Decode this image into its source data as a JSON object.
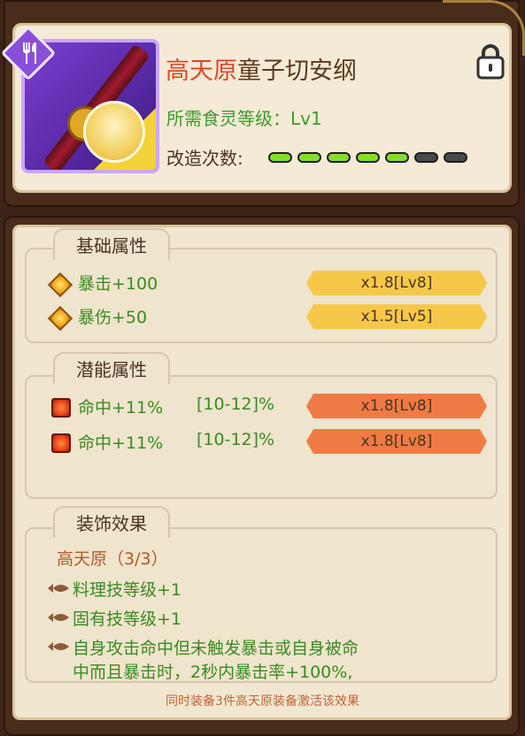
{
  "item": {
    "name_prefix": "高天原",
    "name_main": "童子切安纲",
    "requirement": "所需食灵等级：Lv1",
    "modification_label": "改造次数:",
    "modification_filled": 5,
    "modification_total": 7,
    "category_icon": "fork-knife-icon"
  },
  "sections": {
    "basic": {
      "title": "基础属性",
      "rows": [
        {
          "label": "暴击+100",
          "value": "x1.8[Lv8]"
        },
        {
          "label": "暴伤+50",
          "value": "x1.5[Lv5]"
        }
      ]
    },
    "potential": {
      "title": "潜能属性",
      "rows": [
        {
          "label": "命中+11%",
          "range": "[10-12]%",
          "value": "x1.8[Lv8]"
        },
        {
          "label": "命中+11%",
          "range": "[10-12]%",
          "value": "x1.8[Lv8]"
        }
      ]
    },
    "set": {
      "title": "装饰效果",
      "set_name": "高天原（3/3）",
      "effects": [
        "料理技等级+1",
        "固有技等级+1",
        "自身攻击命中但未触发暴击或自身被命",
        "中而且暴击时，2秒内暴击率+100%,"
      ],
      "footer": "同时装备3件高天原装备激活该效果"
    }
  },
  "colors": {
    "frame": "#4a2c1b",
    "panel": "#f1e7d1",
    "green_text": "#3c8a23",
    "title_accent": "#e0462a",
    "banner_yellow": "#f5c84a",
    "banner_orange": "#ef7a45"
  }
}
